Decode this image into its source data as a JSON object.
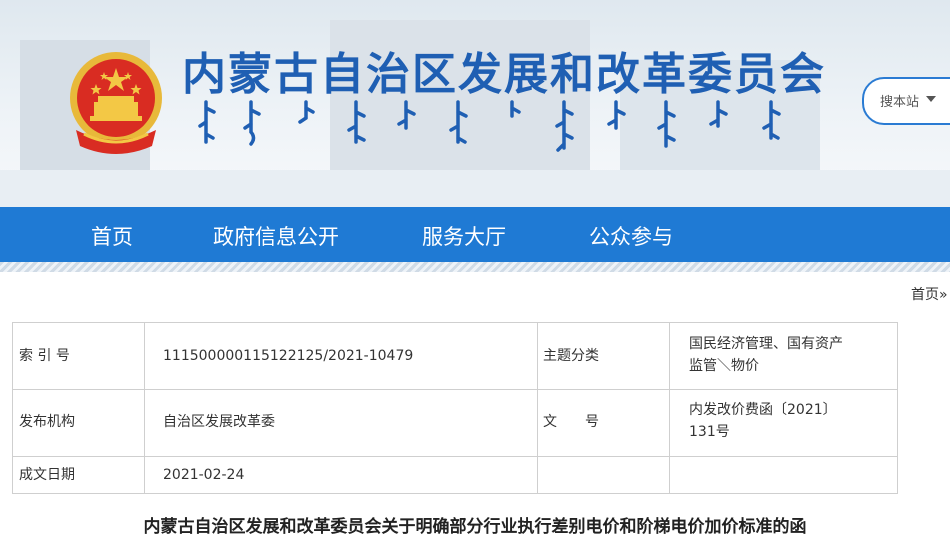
{
  "header": {
    "site_title": "内蒙古自治区发展和改革委员会",
    "search_label": "搜本站"
  },
  "nav": {
    "items": [
      {
        "label": "首页"
      },
      {
        "label": "政府信息公开"
      },
      {
        "label": "服务大厅"
      },
      {
        "label": "公众参与"
      }
    ]
  },
  "breadcrumb": {
    "text": "首页»"
  },
  "meta": {
    "index_label": "索 引 号",
    "index_value": "11150000011512212​5/2021-10479",
    "topic_label": "主题分类",
    "topic_value_line1": "国民经济管理、国有资产",
    "topic_value_line2": "监管＼物价",
    "issuer_label": "发布机构",
    "issuer_value": "自治区发展改革委",
    "docno_label": "文　　号",
    "docno_value_line1": "内发改价费函〔2021〕",
    "docno_value_line2": "131号",
    "date_label": "成文日期",
    "date_value": "2021-02-24"
  },
  "document": {
    "title": "内蒙古自治区发展和改革委员会关于明确部分行业执行差别电价和阶梯电价加价标准的函"
  },
  "colors": {
    "brand_blue": "#1f7ad4",
    "title_blue": "#1f5fb3"
  },
  "icons": {
    "emblem": "national-emblem-icon",
    "search_caret": "caret-down-icon"
  }
}
